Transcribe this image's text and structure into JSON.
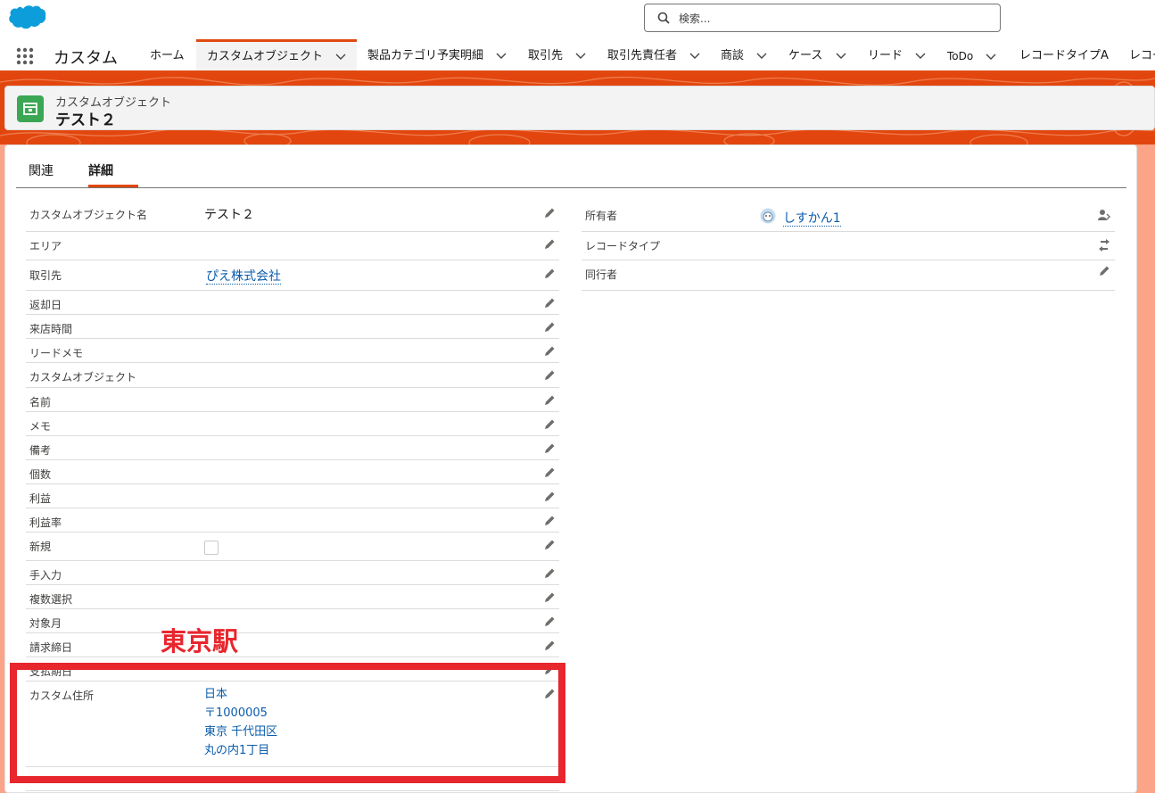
{
  "header": {
    "search_placeholder": "検索...",
    "app_name": "カスタム"
  },
  "nav": {
    "items": [
      {
        "label": "ホーム"
      },
      {
        "label": "カスタムオブジェクト"
      },
      {
        "label": "製品カテゴリ予実明細"
      },
      {
        "label": "取引先"
      },
      {
        "label": "取引先責任者"
      },
      {
        "label": "商談"
      },
      {
        "label": "ケース"
      },
      {
        "label": "リード"
      },
      {
        "label": "ToDo"
      },
      {
        "label": "レコードタイプA"
      },
      {
        "label": "レコー"
      }
    ]
  },
  "record": {
    "object_type": "カスタムオブジェクト",
    "title": "テスト２"
  },
  "tabs": {
    "related": "関連",
    "details": "詳細"
  },
  "left_fields": [
    {
      "label": "カスタムオブジェクト名",
      "value": "テスト２"
    },
    {
      "label": "エリア",
      "value": ""
    },
    {
      "label": "取引先",
      "value": "ぴえ株式会社"
    },
    {
      "label": "返却日",
      "value": ""
    },
    {
      "label": "来店時間",
      "value": ""
    },
    {
      "label": "リードメモ",
      "value": ""
    },
    {
      "label": "カスタムオブジェクト",
      "value": ""
    },
    {
      "label": "名前",
      "value": ""
    },
    {
      "label": "メモ",
      "value": ""
    },
    {
      "label": "備考",
      "value": ""
    },
    {
      "label": "個数",
      "value": ""
    },
    {
      "label": "利益",
      "value": ""
    },
    {
      "label": "利益率",
      "value": ""
    },
    {
      "label": "新規",
      "value": ""
    },
    {
      "label": "手入力",
      "value": ""
    },
    {
      "label": "複数選択",
      "value": ""
    },
    {
      "label": "対象月",
      "value": ""
    },
    {
      "label": "請求締日",
      "value": ""
    },
    {
      "label": "支払期日",
      "value": ""
    },
    {
      "label": "カスタム住所",
      "value": ""
    }
  ],
  "address": {
    "country": "日本",
    "postal": "〒1000005",
    "city": "東京 千代田区",
    "street": "丸の内1丁目"
  },
  "right_fields": [
    {
      "label": "所有者",
      "value": "しすかん1"
    },
    {
      "label": "レコードタイプ",
      "value": ""
    },
    {
      "label": "同行者",
      "value": ""
    }
  ],
  "annotation": {
    "label": "東京駅",
    "color": "#e8262e"
  },
  "colors": {
    "brand_orange": "#e2460e",
    "link_blue": "#0b5cab",
    "record_icon_green": "#3ba755"
  }
}
